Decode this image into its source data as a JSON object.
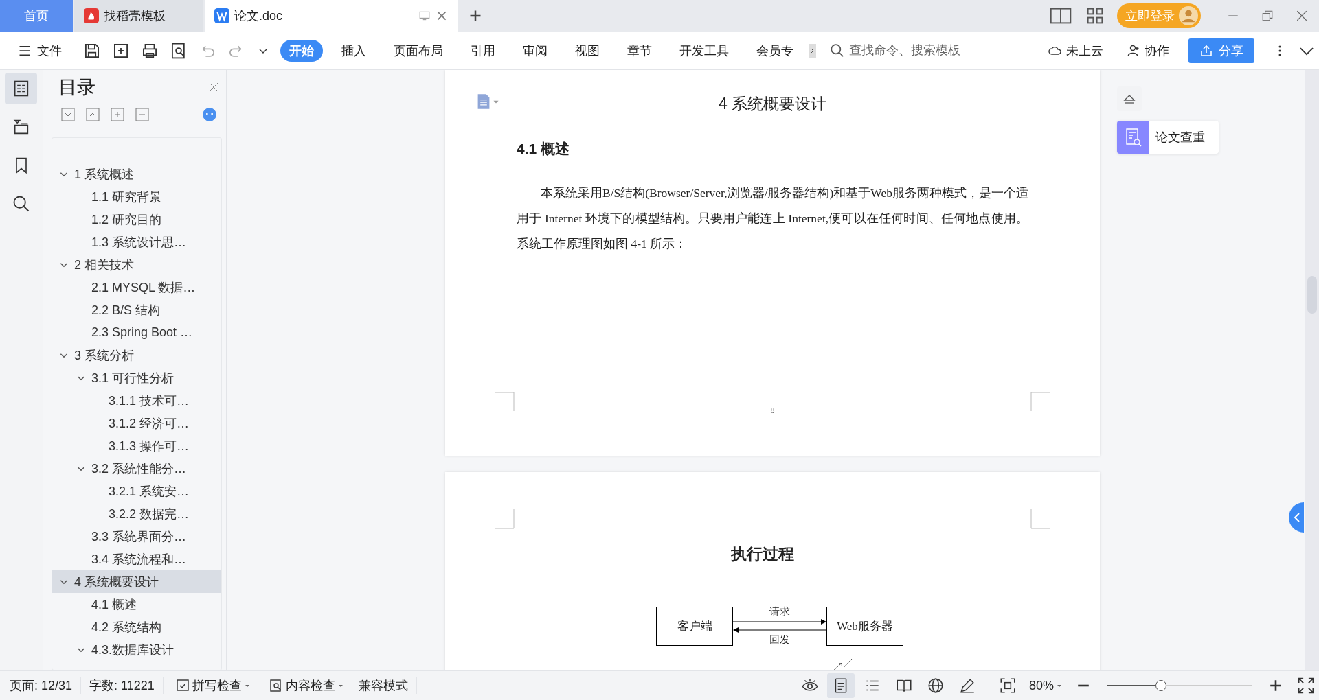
{
  "tabs": [
    {
      "label": "首页",
      "kind": "home",
      "selected": false
    },
    {
      "label": "找稻壳模板",
      "kind": "docer",
      "selected": false
    },
    {
      "label": "论文.doc",
      "kind": "doc",
      "selected": true
    }
  ],
  "login_button": "立即登录",
  "file_menu": "文件",
  "ribbon_tabs": [
    {
      "label": "开始",
      "selected": true
    },
    {
      "label": "插入",
      "selected": false
    },
    {
      "label": "页面布局",
      "selected": false
    },
    {
      "label": "引用",
      "selected": false
    },
    {
      "label": "审阅",
      "selected": false
    },
    {
      "label": "视图",
      "selected": false
    },
    {
      "label": "章节",
      "selected": false
    },
    {
      "label": "开发工具",
      "selected": false
    },
    {
      "label": "会员专",
      "selected": false
    }
  ],
  "command_search": {
    "placeholder": "查找命令、搜索模板"
  },
  "cloud_status": "未上云",
  "collaborate": "协作",
  "share": "分享",
  "left_rail": [
    {
      "kind": "toc",
      "selected": true
    },
    {
      "kind": "navigation",
      "selected": false
    },
    {
      "kind": "bookmark",
      "selected": false
    },
    {
      "kind": "search",
      "selected": false
    }
  ],
  "toc": {
    "title": "目录",
    "items": [
      {
        "label": "1 系统概述",
        "selected": false,
        "expanded": true,
        "children": [
          {
            "label": "1.1  研究背景",
            "selected": false
          },
          {
            "label": "1.2 研究目的",
            "selected": false
          },
          {
            "label": "1.3 系统设计思…",
            "selected": false
          }
        ]
      },
      {
        "label": "2 相关技术",
        "selected": false,
        "expanded": true,
        "children": [
          {
            "label": "2.1 MYSQL 数据…",
            "selected": false
          },
          {
            "label": "2.2 B/S 结构",
            "selected": false
          },
          {
            "label": "2.3 Spring Boot …",
            "selected": false
          }
        ]
      },
      {
        "label": "3 系统分析",
        "selected": false,
        "expanded": true,
        "children": [
          {
            "label": "3.1 可行性分析",
            "selected": false,
            "expanded": true,
            "children": [
              {
                "label": "3.1.1 技术可…",
                "selected": false
              },
              {
                "label": "3.1.2 经济可…",
                "selected": false
              },
              {
                "label": "3.1.3 操作可…",
                "selected": false
              }
            ]
          },
          {
            "label": "3.2 系统性能分…",
            "selected": false,
            "expanded": true,
            "children": [
              {
                "label": "3.2.1  系统安…",
                "selected": false
              },
              {
                "label": "3.2.2  数据完…",
                "selected": false
              }
            ]
          },
          {
            "label": "3.3 系统界面分…",
            "selected": false
          },
          {
            "label": "3.4 系统流程和…",
            "selected": false
          }
        ]
      },
      {
        "label": "4 系统概要设计",
        "selected": true,
        "expanded": true,
        "children": [
          {
            "label": "4.1 概述",
            "selected": false
          },
          {
            "label": "4.2 系统结构",
            "selected": false
          },
          {
            "label": "4.3.数据库设计",
            "selected": false,
            "expanded": true
          }
        ]
      }
    ]
  },
  "page_1": {
    "heading": "4 系统概要设计",
    "section": "4.1 概述",
    "paragraph": "本系统采用B/S结构(Browser/Server,浏览器/服务器结构)和基于Web服务两种模式，是一个适用于 Internet 环境下的模型结构。只要用户能连上 Internet,便可以在任何时间、任何地点使用。系统工作原理图如图 4-1 所示：",
    "page_number": "8"
  },
  "page_2": {
    "figure_title": "执行过程",
    "client": "客户端",
    "server": "Web服务器",
    "request": "请求",
    "response": "回发"
  },
  "side_panel": {
    "plagiarism_check": "论文查重"
  },
  "status_bar": {
    "page": "页面: 12/31",
    "words": "字数: 11221",
    "spell_check": "拼写检查",
    "content_check": "内容检查",
    "mode": "兼容模式",
    "zoom": "80%",
    "zoom_slider": {
      "level": 0.37
    }
  },
  "view_modes": [
    {
      "kind": "page",
      "selected": true
    },
    {
      "kind": "outline",
      "selected": false
    },
    {
      "kind": "reading",
      "selected": false
    },
    {
      "kind": "web",
      "selected": false
    },
    {
      "kind": "write",
      "selected": false
    }
  ]
}
